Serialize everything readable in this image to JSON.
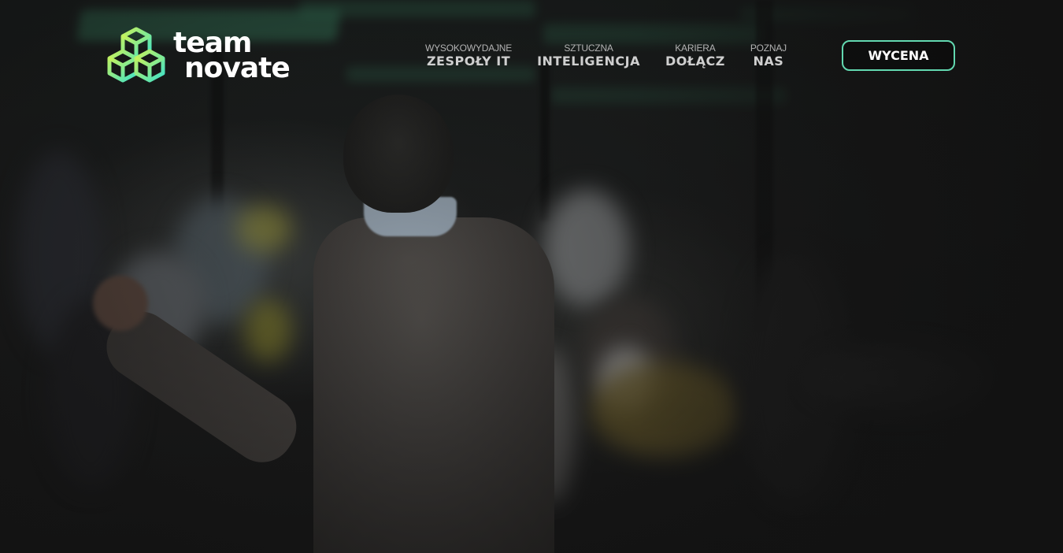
{
  "brand": {
    "logo_line1": "team",
    "logo_line2": "novate",
    "logo_icon": "cubes-logo-icon",
    "gradient_colors": [
      "#c8f25a",
      "#3fe2c8"
    ]
  },
  "nav": {
    "items": [
      {
        "small": "WYSOKOWYDAJNE",
        "big": "ZESPOŁY IT"
      },
      {
        "small": "SZTUCZNA",
        "big": "INTELIGENCJA"
      },
      {
        "small": "KARIERA",
        "big": "DOŁĄCZ"
      },
      {
        "small": "POZNAJ",
        "big": "NAS"
      }
    ]
  },
  "cta": {
    "label": "WYCENA",
    "border_color": "#62d8b0"
  },
  "hero": {
    "background_image": "blurred-photo-speaker-presenting-to-audience"
  }
}
